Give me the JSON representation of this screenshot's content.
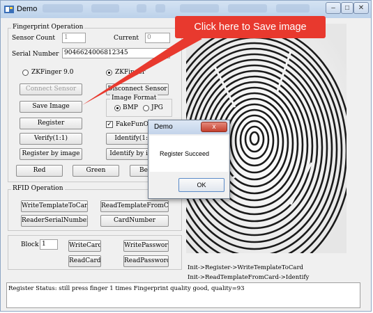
{
  "window": {
    "title": "Demo",
    "minimize_glyph": "–",
    "maximize_glyph": "□",
    "close_glyph": "✕"
  },
  "fingerprint": {
    "group_label": "Fingerprint Operation",
    "sensor_count_label": "Sensor Count",
    "sensor_count_value": "1",
    "current_label": "Current",
    "current_value": "0",
    "serial_label": "Serial Number",
    "serial_value": "9046624006812345",
    "radio_zk9": "ZKFinger 9.0",
    "radio_zk10": "ZKFinger",
    "connect_sensor": "Connect Sensor",
    "disconnect_sensor": "Disconnect Sensor",
    "save_image": "Save Image",
    "image_format_label": "Image Format",
    "format_bmp": "BMP",
    "format_jpg": "JPG",
    "register": "Register",
    "fake_fun_on": "FakeFunOn",
    "verify": "Verify(1:1)",
    "identify": "Identify(1:",
    "register_by_image": "Register by image",
    "identify_by_image": "Identify by i",
    "red": "Red",
    "green": "Green",
    "beep": "Be"
  },
  "rfid": {
    "group_label": "RFID Operation",
    "write_template": "WriteTemplateToCard",
    "read_template": "ReadTemplateFromCard",
    "reader_serial": "ReaderSerialNumber",
    "card_number": "CardNumber",
    "block_label": "Block",
    "block_value": "1",
    "write_card": "WriteCard",
    "write_password": "WritePassword",
    "read_card": "ReadCard",
    "read_password": "ReadPassword"
  },
  "flow_notes": [
    "Init->Register->WriteTemplateToCard",
    "Init->ReadTemplateFromCard->Identify"
  ],
  "status_text": "Register Status: still press finger 1 times Fingerprint quality good, quality=93",
  "callout": {
    "text": "Click here to Save image",
    "color": "#e8392e"
  },
  "dialog": {
    "title": "Demo",
    "close_glyph": "x",
    "message": "Register Succeed",
    "ok": "OK"
  },
  "colors": {
    "accent": "#e8392e",
    "titlebar": "#c9daef"
  }
}
